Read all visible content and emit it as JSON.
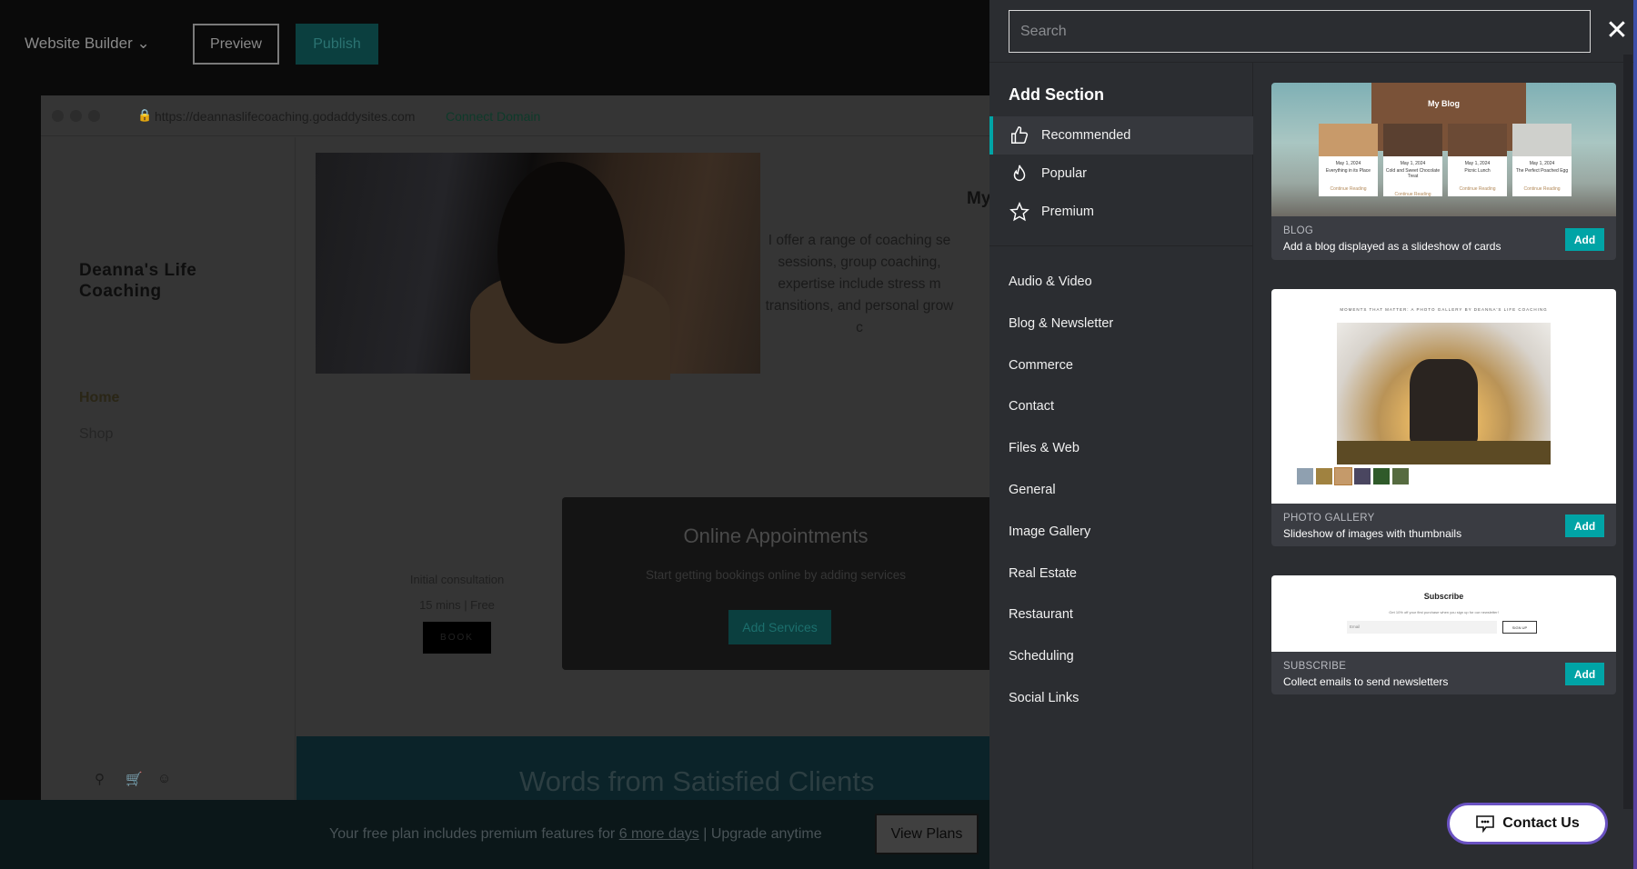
{
  "topbar": {
    "brand": "Website Builder",
    "preview": "Preview",
    "publish": "Publish"
  },
  "browser": {
    "url": "https://deannaslifecoaching.godaddysites.com",
    "connect_domain": "Connect Domain"
  },
  "site": {
    "title": "Deanna's Life Coaching",
    "nav": [
      "Home",
      "Shop"
    ],
    "heading_partial": "My",
    "paragraph_lines": [
      "I offer a range of coaching se",
      "sessions, group coaching,",
      "expertise include stress m",
      "transitions, and personal grow",
      "c"
    ],
    "service": {
      "name": "Initial consultation",
      "meta": "15 mins  |  Free",
      "book": "BOOK"
    },
    "appointments": {
      "title": "Online Appointments",
      "subtitle": "Start getting bookings online by adding services",
      "button": "Add Services"
    },
    "testimonials_heading": "Words from Satisfied Clients"
  },
  "banner": {
    "text": "Your free plan includes premium features for",
    "link": "6 more days",
    "sep": "|",
    "upgrade": "Upgrade anytime",
    "button": "View Plans"
  },
  "panel": {
    "search_placeholder": "Search",
    "heading": "Add Section",
    "filters": [
      {
        "label": "Recommended",
        "icon": "thumbs-up-icon",
        "active": true
      },
      {
        "label": "Popular",
        "icon": "flame-icon"
      },
      {
        "label": "Premium",
        "icon": "star-icon"
      }
    ],
    "categories": [
      "Audio & Video",
      "Blog & Newsletter",
      "Commerce",
      "Contact",
      "Files & Web",
      "General",
      "Image Gallery",
      "Real Estate",
      "Restaurant",
      "Scheduling",
      "Social Links"
    ],
    "cards": [
      {
        "category": "BLOG",
        "description": "Add a blog displayed as a slideshow of cards",
        "add": "Add",
        "preview": {
          "title": "My Blog",
          "posts": [
            {
              "date": "May 1, 2024",
              "title": "Everything in its Place"
            },
            {
              "date": "May 1, 2024",
              "title": "Cold and Sweet Chocolate Treat"
            },
            {
              "date": "May 1, 2024",
              "title": "Picnic Lunch"
            },
            {
              "date": "May 1, 2024",
              "title": "The Perfect Poached Egg"
            }
          ],
          "link": "Continue Reading"
        }
      },
      {
        "category": "PHOTO GALLERY",
        "description": "Slideshow of images with thumbnails",
        "add": "Add",
        "preview": {
          "title": "MOMENTS THAT MATTER: A PHOTO GALLERY BY DEANNA'S LIFE COACHING"
        }
      },
      {
        "category": "SUBSCRIBE",
        "description": "Collect emails to send newsletters",
        "add": "Add",
        "preview": {
          "title": "Subscribe",
          "text": "Get 10% off your first purchase when you sign up for our newsletter!",
          "email": "Email",
          "button": "SIGN UP"
        }
      }
    ]
  },
  "contact": {
    "label": "Contact Us"
  },
  "colors": {
    "accent": "#00a4a6",
    "panel_bg": "#2b2d31",
    "contact_border": "#6a52c2"
  }
}
